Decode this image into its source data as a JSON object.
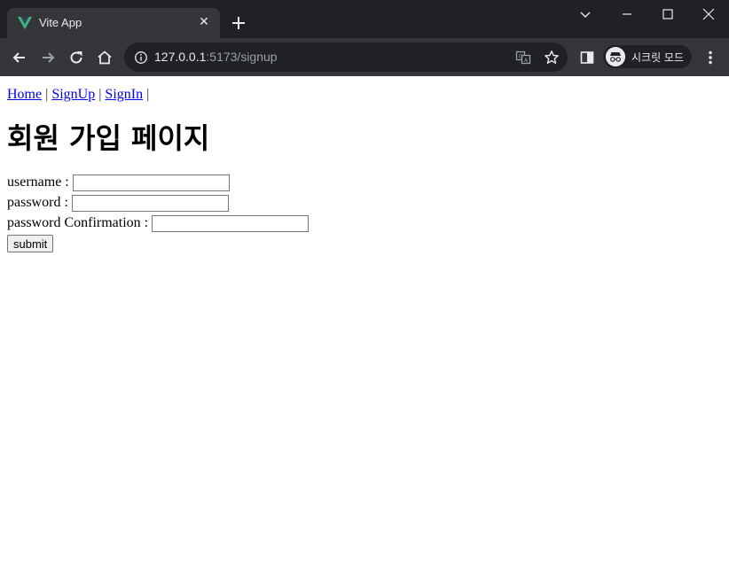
{
  "browser": {
    "tab_title": "Vite App",
    "url_host": "127.0.0.1",
    "url_path": ":5173/signup",
    "incognito_label": "시크릿 모드"
  },
  "nav": {
    "links": [
      "Home",
      "SignUp",
      "SignIn"
    ],
    "separator": "|"
  },
  "page_title": "회원 가입 페이지",
  "form": {
    "username_label": "username :",
    "username_value": "",
    "password_label": "password :",
    "password_value": "",
    "confirm_label": "password Confirmation :",
    "confirm_value": "",
    "submit_label": "submit"
  },
  "icons": {
    "favicon": "vue-logo-icon",
    "tab_close": "close-icon",
    "new_tab": "plus-icon",
    "back": "back-arrow-icon",
    "forward": "forward-arrow-icon",
    "reload": "reload-icon",
    "home": "home-icon",
    "info": "info-icon",
    "translate": "translate-icon",
    "bookmark": "star-icon",
    "side_panel": "side-panel-icon",
    "incognito": "incognito-icon",
    "menu": "kebab-menu-icon"
  }
}
